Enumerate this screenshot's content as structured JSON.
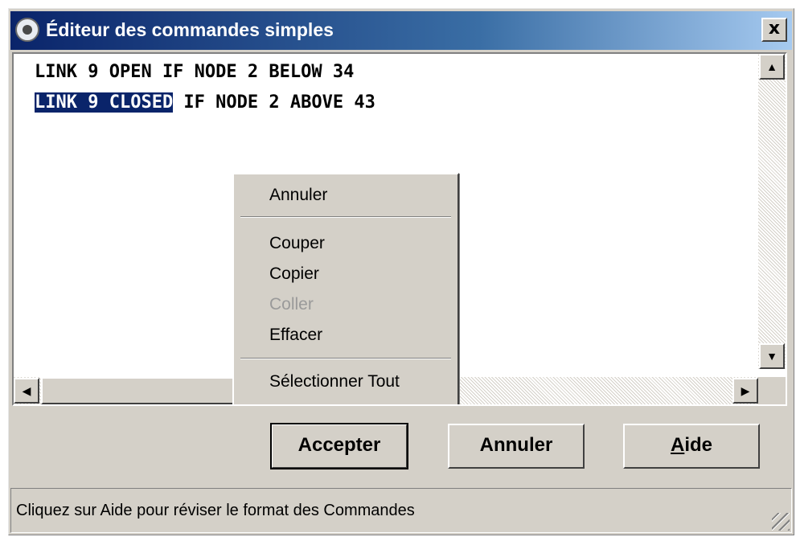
{
  "window": {
    "title": "Éditeur des commandes simples",
    "close_label": "x"
  },
  "editor": {
    "line1": "LINK 9 OPEN IF NODE 2 BELOW 34",
    "line2_selected": "LINK 9 CLOSED",
    "line2_rest": " IF NODE 2 ABOVE 43"
  },
  "context_menu": {
    "undo": "Annuler",
    "cut": "Couper",
    "copy": "Copier",
    "paste": "Coller",
    "delete": "Effacer",
    "select_all": "Sélectionner Tout"
  },
  "buttons": {
    "accept": "Accepter",
    "cancel": "Annuler",
    "help_mnemonic": "A",
    "help_rest": "ide"
  },
  "status": {
    "text": "Cliquez sur Aide pour réviser le format des Commandes"
  },
  "colors": {
    "title_bar": "#0a246a",
    "selection": "#0a246a",
    "face": "#d4d0c8"
  }
}
